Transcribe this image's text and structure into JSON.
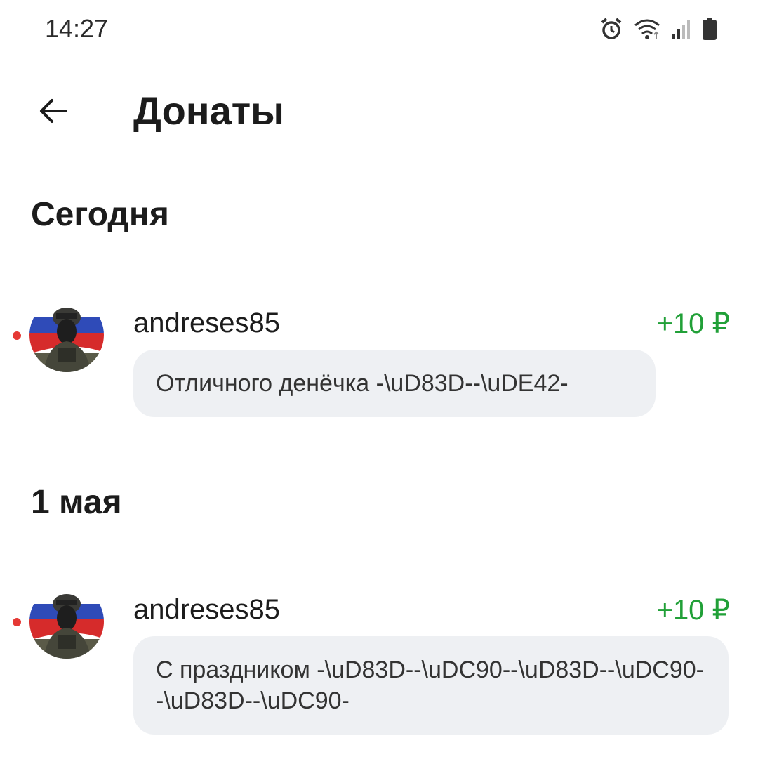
{
  "status_bar": {
    "time": "14:27",
    "icons": [
      "alarm-icon",
      "wifi-icon",
      "signal-icon",
      "battery-icon"
    ]
  },
  "header": {
    "back_icon": "arrow-left-icon",
    "title": "Донаты"
  },
  "colors": {
    "amount": "#21a038",
    "unread_dot": "#e53935",
    "bubble_bg": "#eef0f3"
  },
  "sections": [
    {
      "title": "Сегодня",
      "items": [
        {
          "username": "andreses85",
          "amount": "+10 ₽",
          "message": "Отличного денёчка -\\uD83D--\\uDE42-",
          "unread": true
        }
      ]
    },
    {
      "title": "1 мая",
      "items": [
        {
          "username": "andreses85",
          "amount": "+10 ₽",
          "message": "С праздником -\\uD83D--\\uDC90--\\uD83D--\\uDC90--\\uD83D--\\uDC90-",
          "unread": true
        }
      ]
    }
  ]
}
